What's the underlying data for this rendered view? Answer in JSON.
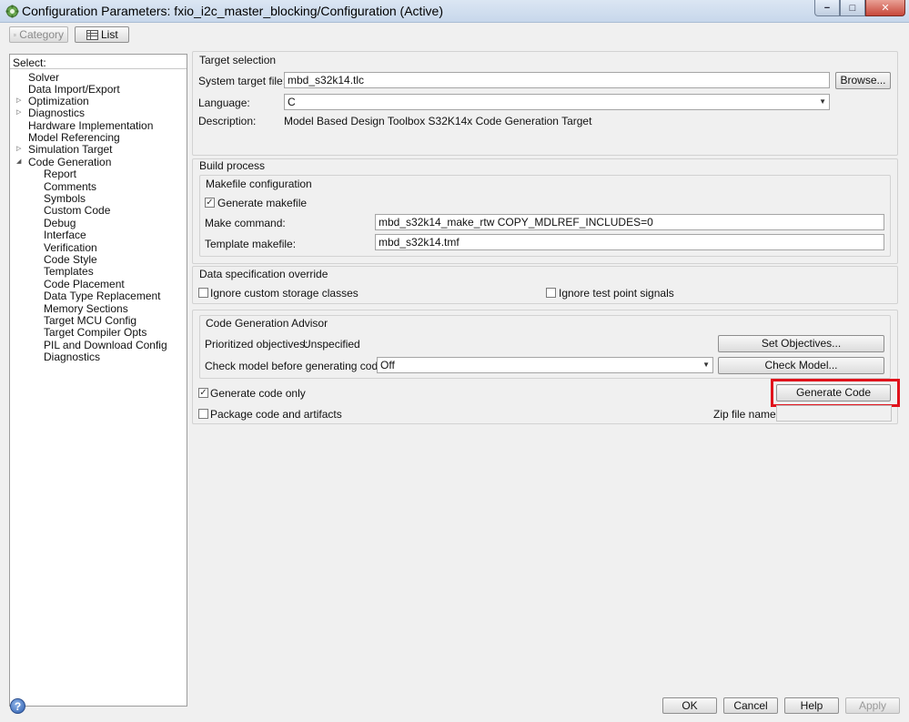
{
  "window": {
    "title": "Configuration Parameters: fxio_i2c_master_blocking/Configuration (Active)",
    "minimize": "−",
    "maximize": "□",
    "close": "✕"
  },
  "toolbar": {
    "category_label": "Category",
    "list_label": "List"
  },
  "tree": {
    "header": "Select:",
    "items": [
      {
        "label": "Solver"
      },
      {
        "label": "Data Import/Export"
      },
      {
        "label": "Optimization"
      },
      {
        "label": "Diagnostics"
      },
      {
        "label": "Hardware Implementation"
      },
      {
        "label": "Model Referencing"
      },
      {
        "label": "Simulation Target"
      },
      {
        "label": "Code Generation"
      },
      {
        "label": "Report"
      },
      {
        "label": "Comments"
      },
      {
        "label": "Symbols"
      },
      {
        "label": "Custom Code"
      },
      {
        "label": "Debug"
      },
      {
        "label": "Interface"
      },
      {
        "label": "Verification"
      },
      {
        "label": "Code Style"
      },
      {
        "label": "Templates"
      },
      {
        "label": "Code Placement"
      },
      {
        "label": "Data Type Replacement"
      },
      {
        "label": "Memory Sections"
      },
      {
        "label": "Target MCU Config"
      },
      {
        "label": "Target Compiler Opts"
      },
      {
        "label": "PIL and Download Config"
      },
      {
        "label": "Diagnostics"
      }
    ]
  },
  "target_selection": {
    "title": "Target selection",
    "system_target_label": "System target file:",
    "system_target_value": "mbd_s32k14.tlc",
    "browse_label": "Browse...",
    "language_label": "Language:",
    "language_value": "C",
    "description_label": "Description:",
    "description_value": "Model Based Design Toolbox S32K14x Code Generation Target"
  },
  "build_process": {
    "title": "Build process",
    "makefile_config_title": "Makefile configuration",
    "generate_makefile_label": "Generate makefile",
    "generate_makefile_checked": true,
    "make_command_label": "Make command:",
    "make_command_value": "mbd_s32k14_make_rtw COPY_MDLREF_INCLUDES=0",
    "template_makefile_label": "Template makefile:",
    "template_makefile_value": "mbd_s32k14.tmf"
  },
  "data_spec": {
    "title": "Data specification override",
    "ignore_storage_label": "Ignore custom storage classes",
    "ignore_storage_checked": false,
    "ignore_testpoint_label": "Ignore test point signals",
    "ignore_testpoint_checked": false
  },
  "advisor": {
    "title": "Code Generation Advisor",
    "objectives_label": "Prioritized objectives:",
    "objectives_value": "Unspecified",
    "set_objectives_label": "Set Objectives...",
    "check_model_label": "Check model before generating code:",
    "check_model_value": "Off",
    "check_model_button": "Check Model..."
  },
  "generation": {
    "generate_code_only_label": "Generate code only",
    "generate_code_only_checked": true,
    "generate_code_button": "Generate Code",
    "package_label": "Package code and artifacts",
    "package_checked": false,
    "zip_label": "Zip file name:",
    "zip_value": ""
  },
  "footer": {
    "ok_label": "OK",
    "cancel_label": "Cancel",
    "help_label": "Help",
    "apply_label": "Apply",
    "help_icon_glyph": "?"
  },
  "colors": {
    "highlight": "#e0121b",
    "titlebar": "#c7d7eb"
  }
}
